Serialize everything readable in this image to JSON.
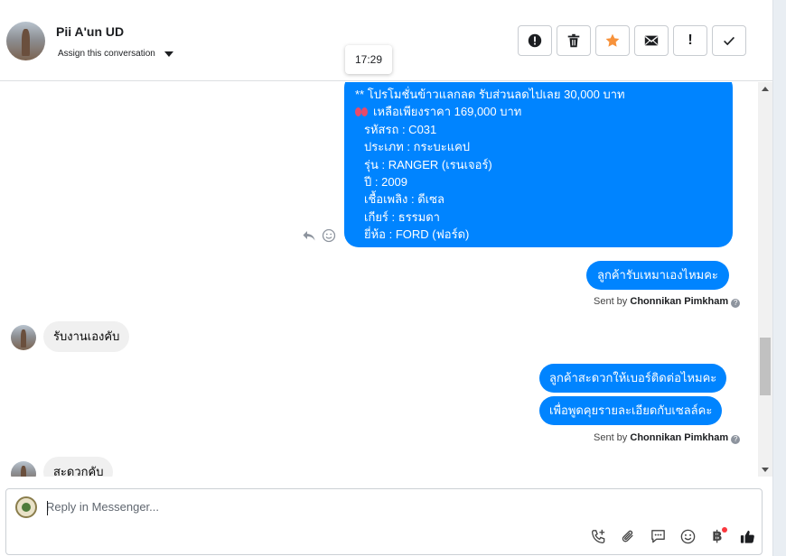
{
  "header": {
    "contact_name": "Pii A'un UD",
    "assign_label": "Assign this conversation",
    "actions": [
      {
        "name": "mark-spam",
        "icon": "exclamation-circle-icon"
      },
      {
        "name": "delete",
        "icon": "trash-icon"
      },
      {
        "name": "star",
        "icon": "star-icon",
        "color": "#f7923b"
      },
      {
        "name": "mark-unread",
        "icon": "envelope-icon"
      },
      {
        "name": "follow-up",
        "label": "!"
      },
      {
        "name": "mark-done",
        "icon": "check-icon"
      }
    ]
  },
  "tooltip": {
    "time": "17:29"
  },
  "colors": {
    "outgoing": "#0084ff",
    "incoming": "#f0f0f0"
  },
  "messages": {
    "promo": {
      "lines": [
        "** โปรโมชั่นข้าวแลกลด รับส่วนลดไปเลย 30,000 บาท",
        "เหลือเพียงราคา 169,000 บาท",
        "รหัสรถ : C031",
        "ประเภท : กระบะแคป",
        "รุ่น : RANGER (เรนเจอร์)",
        "ปี : 2009",
        "เชื้อเพลิง : ดีเซล",
        "เกียร์ : ธรรมดา",
        "ยี่ห้อ : FORD (ฟอร์ด)"
      ]
    },
    "out_1": "ลูกค้ารับเหมาเองไหมคะ",
    "sent_by_prefix": "Sent by",
    "sent_by_name": "Chonnikan Pimkham",
    "in_1": "รับงานเองคับ",
    "out_2": "ลูกค้าสะดวกให้เบอร์ติดต่อไหมคะ",
    "out_3": "เพื่อพูดคุยรายละเอียดกับเซลล์คะ",
    "in_2": "สะดวกคับ"
  },
  "composer": {
    "placeholder": "Reply in Messenger...",
    "tools": [
      "phone-add-icon",
      "paperclip-icon",
      "chat-bubble-icon",
      "smiley-icon",
      "baht-icon",
      "thumbs-up-icon"
    ],
    "baht_symbol": "฿"
  }
}
